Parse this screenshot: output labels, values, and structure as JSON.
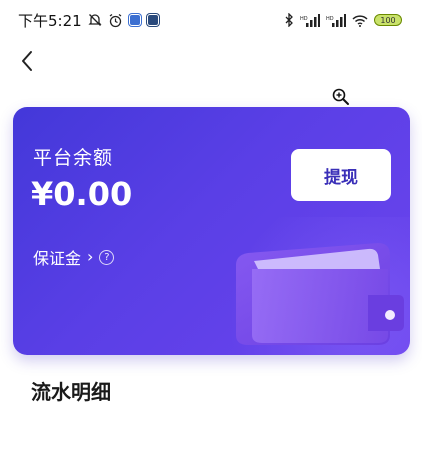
{
  "status_bar": {
    "time": "下午5:21",
    "battery": "100"
  },
  "card": {
    "balance_label": "平台余额",
    "balance_value": "¥0.00",
    "withdraw_label": "提现",
    "deposit_label": "保证金",
    "deposit_chevron": "›",
    "help_symbol": "?"
  },
  "section": {
    "title": "流水明细"
  },
  "icons": {
    "back": "back-arrow-icon",
    "zoom": "zoom-in-icon",
    "help": "question-circle-icon",
    "wallet": "wallet-illustration"
  },
  "colors": {
    "card_start": "#4338d9",
    "card_end": "#6c44ee",
    "accent_text": "#3a2fb8"
  }
}
